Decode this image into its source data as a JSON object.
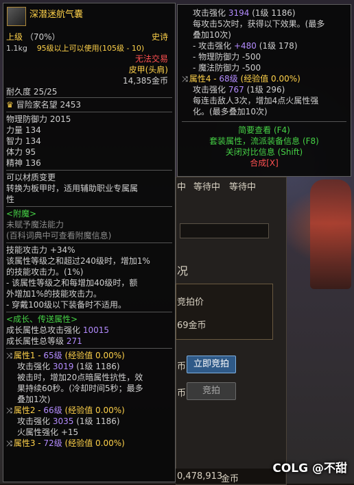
{
  "background": {
    "status_1": "等待中",
    "status_2": "等待中",
    "status_prefix": "中",
    "tab_input": "",
    "blur_text": "况",
    "bid_price_label": "竞拍价",
    "gold_fragment": "69金币",
    "instant_buy_prefix": "币",
    "instant_buy": "立即竞拍",
    "bid_prefix": "币",
    "bid": "竞拍",
    "total_gold": "0,478,913",
    "total_gold_suffix": "金币"
  },
  "left_tooltip": {
    "item_name": "深潜迷航气囊",
    "grade": "上级",
    "grade_pct": "（70%）",
    "rarity": "史诗",
    "weight": "1.1kg",
    "level_req": "95级以上可以使用(105级 - 10)",
    "trade": "无法交易",
    "type": "皮甲(头肩)",
    "price": "14,385金币",
    "durability": "耐久度 25/25",
    "fame_label": "冒险家名望",
    "fame_value": "2453",
    "stats": [
      {
        "label": "物理防御力",
        "value": "2015"
      },
      {
        "label": "力量",
        "value": "134"
      },
      {
        "label": "智力",
        "value": "134"
      },
      {
        "label": "体力",
        "value": "95"
      },
      {
        "label": "精神",
        "value": "136"
      }
    ],
    "material_1": "可以材质变更",
    "material_2": "转换为板甲时，适用辅助职业专属属",
    "material_3": "性",
    "enchant_title": "<附魔>",
    "enchant_1": "未赋予魔法能力",
    "enchant_2": "(百科词典中可查看附魔信息)",
    "skill_1": "技能攻击力 +34%",
    "skill_2": "该属性等级之和超过240级时，增加1%",
    "skill_3": "的技能攻击力。(1%)",
    "skill_4": "- 该属性等级之和每增加40级时，额",
    "skill_5": "外增加1%的技能攻击力。",
    "skill_6": "- 穿戴100级以下装备时不适用。",
    "growth_title": "<成长、传送属性>",
    "growth_atk_label": "成长属性总攻击强化",
    "growth_atk_value": "10015",
    "growth_lv_label": "成长属性总等级",
    "growth_lv_value": "271",
    "attr1_label": "属性1 - ",
    "attr1_lv": "65级",
    "attr1_exp": "(经验值 0.00%)",
    "attr1_atk_label": "攻击强化",
    "attr1_atk_value": "3019",
    "attr1_atk_lv": "(1级 1186)",
    "attr1_desc_1": "被击时，增加20点暗属性抗性，效",
    "attr1_desc_2": "果持续60秒。(冷却时间5秒；最多",
    "attr1_desc_3": "叠加1次)",
    "attr2_label": "属性2 - ",
    "attr2_lv": "66级",
    "attr2_exp": "(经验值 0.00%)",
    "attr2_atk_label": "攻击强化",
    "attr2_atk_value": "3035",
    "attr2_atk_lv": "(1级 1186)",
    "attr2_fire": "火属性强化 +15",
    "attr3_label": "属性3 - ",
    "attr3_lv": "72级",
    "attr3_exp": "(经验值 0.00%)"
  },
  "right_tooltip": {
    "atk_label": "攻击强化",
    "atk_value": "3194",
    "atk_lv": "(1级 1186)",
    "desc_1": "每攻击5次时，获得以下效果。(最多",
    "desc_2": "叠加10次)",
    "eff_1_label": "- 攻击强化",
    "eff_1_value": "+480",
    "eff_1_lv": "(1级 178)",
    "eff_2": "- 物理防御力 -500",
    "eff_3": "- 魔法防御力 -500",
    "attr4_label": "属性4 - ",
    "attr4_lv": "68级",
    "attr4_exp": "(经验值 0.00%)",
    "attr4_atk_label": "攻击强化",
    "attr4_atk_value": "767",
    "attr4_atk_lv": "(1级 296)",
    "attr4_desc_1": "每连击敌人3次，增加4点火属性强",
    "attr4_desc_2": "化。(最多叠加10次)",
    "link_simple": "简要查看 (F4)",
    "link_set": "套装属性，流派装备信息 (F8)",
    "link_close": "关闭对比信息 (Shift)",
    "link_synth": "合成[X]"
  },
  "watermark": "COLG @不甜"
}
